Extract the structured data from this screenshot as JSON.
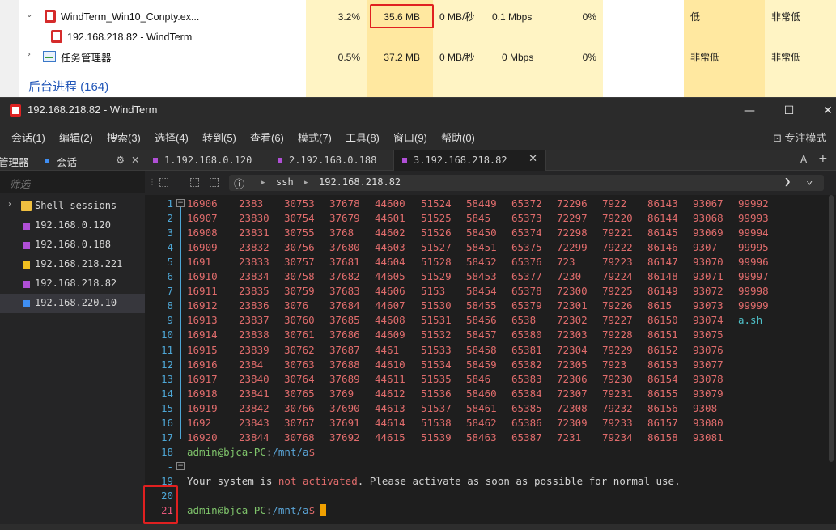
{
  "taskmanager": {
    "rows": [
      {
        "name": "WindTerm_Win10_Conpty.ex...",
        "cpu": "3.2%",
        "memory": "35.6 MB",
        "disk": "0 MB/秒",
        "network": "0.1 Mbps",
        "gpu": "0%",
        "power": "低",
        "power_trend": "非常低"
      },
      {
        "name": "192.168.218.82 - WindTerm"
      },
      {
        "name": "任务管理器",
        "cpu": "0.5%",
        "memory": "37.2 MB",
        "disk": "0 MB/秒",
        "network": "0 Mbps",
        "gpu": "0%",
        "power": "非常低",
        "power_trend": "非常低"
      }
    ],
    "section_title": "后台进程 (164)"
  },
  "windterm": {
    "title": "192.168.218.82 - WindTerm",
    "window_buttons": {
      "minimize": "—",
      "maximize": "☐",
      "close": "✕"
    },
    "menu": [
      "会话(1)",
      "编辑(2)",
      "搜索(3)",
      "选择(4)",
      "转到(5)",
      "查看(6)",
      "模式(7)",
      "工具(8)",
      "窗口(9)",
      "帮助(0)"
    ],
    "focus_mode": "⊡ 专注模式",
    "sidebar": {
      "tab_manager": "管理器",
      "tab_session": "会话",
      "filter_placeholder": "筛选",
      "folder": "Shell sessions",
      "items": [
        {
          "label": "192.168.0.120",
          "color": "#b04fd6"
        },
        {
          "label": "192.168.0.188",
          "color": "#b04fd6"
        },
        {
          "label": "192.168.218.221",
          "color": "#f0c020"
        },
        {
          "label": "192.168.218.82",
          "color": "#b04fd6"
        },
        {
          "label": "192.168.220.10",
          "color": "#3f8ef2"
        }
      ]
    },
    "tabs": [
      {
        "label": "1.192.168.0.120",
        "color": "#b04fd6"
      },
      {
        "label": "2.192.168.0.188",
        "color": "#b04fd6"
      },
      {
        "label": "3.192.168.218.82",
        "color": "#b04fd6",
        "close": "✕"
      }
    ],
    "tabbar_right": {
      "a": "A",
      "plus": "+"
    },
    "toolbar": {
      "info": "ⓘ",
      "seg1": "ssh",
      "seg2": "192.168.218.82",
      "arrow": "❯",
      "chev": "⌄"
    },
    "terminal": {
      "grid": [
        [
          "16906",
          "2383",
          "30753",
          "37678",
          "44600",
          "51524",
          "58449",
          "65372",
          "72296",
          "7922",
          "86143",
          "93067",
          "99992"
        ],
        [
          "16907",
          "23830",
          "30754",
          "37679",
          "44601",
          "51525",
          "5845",
          "65373",
          "72297",
          "79220",
          "86144",
          "93068",
          "99993"
        ],
        [
          "16908",
          "23831",
          "30755",
          "3768",
          "44602",
          "51526",
          "58450",
          "65374",
          "72298",
          "79221",
          "86145",
          "93069",
          "99994"
        ],
        [
          "16909",
          "23832",
          "30756",
          "37680",
          "44603",
          "51527",
          "58451",
          "65375",
          "72299",
          "79222",
          "86146",
          "9307",
          "99995"
        ],
        [
          "1691",
          "23833",
          "30757",
          "37681",
          "44604",
          "51528",
          "58452",
          "65376",
          "723",
          "79223",
          "86147",
          "93070",
          "99996"
        ],
        [
          "16910",
          "23834",
          "30758",
          "37682",
          "44605",
          "51529",
          "58453",
          "65377",
          "7230",
          "79224",
          "86148",
          "93071",
          "99997"
        ],
        [
          "16911",
          "23835",
          "30759",
          "37683",
          "44606",
          "5153",
          "58454",
          "65378",
          "72300",
          "79225",
          "86149",
          "93072",
          "99998"
        ],
        [
          "16912",
          "23836",
          "3076",
          "37684",
          "44607",
          "51530",
          "58455",
          "65379",
          "72301",
          "79226",
          "8615",
          "93073",
          "99999"
        ],
        [
          "16913",
          "23837",
          "30760",
          "37685",
          "44608",
          "51531",
          "58456",
          "6538",
          "72302",
          "79227",
          "86150",
          "93074",
          "a.sh"
        ],
        [
          "16914",
          "23838",
          "30761",
          "37686",
          "44609",
          "51532",
          "58457",
          "65380",
          "72303",
          "79228",
          "86151",
          "93075",
          ""
        ],
        [
          "16915",
          "23839",
          "30762",
          "37687",
          "4461",
          "51533",
          "58458",
          "65381",
          "72304",
          "79229",
          "86152",
          "93076",
          ""
        ],
        [
          "16916",
          "2384",
          "30763",
          "37688",
          "44610",
          "51534",
          "58459",
          "65382",
          "72305",
          "7923",
          "86153",
          "93077",
          ""
        ],
        [
          "16917",
          "23840",
          "30764",
          "37689",
          "44611",
          "51535",
          "5846",
          "65383",
          "72306",
          "79230",
          "86154",
          "93078",
          ""
        ],
        [
          "16918",
          "23841",
          "30765",
          "3769",
          "44612",
          "51536",
          "58460",
          "65384",
          "72307",
          "79231",
          "86155",
          "93079",
          ""
        ],
        [
          "16919",
          "23842",
          "30766",
          "37690",
          "44613",
          "51537",
          "58461",
          "65385",
          "72308",
          "79232",
          "86156",
          "9308",
          ""
        ],
        [
          "1692",
          "23843",
          "30767",
          "37691",
          "44614",
          "51538",
          "58462",
          "65386",
          "72309",
          "79233",
          "86157",
          "93080",
          ""
        ],
        [
          "16920",
          "23844",
          "30768",
          "37692",
          "44615",
          "51539",
          "58463",
          "65387",
          "7231",
          "79234",
          "86158",
          "93081",
          ""
        ]
      ],
      "line_numbers": [
        "1",
        "2",
        "3",
        "4",
        "5",
        "6",
        "7",
        "8",
        "9",
        "10",
        "11",
        "12",
        "13",
        "14",
        "15",
        "16",
        "17",
        "18",
        "-",
        "19",
        "20",
        "21"
      ],
      "prompt_user": "admin@bjca-PC",
      "prompt_sep": ":",
      "prompt_path": "/mnt/a",
      "prompt_dollar": "$",
      "msg_a": "Your system is ",
      "msg_b": "not activated",
      "msg_c": ". Please activate as soon as possible for normal use."
    }
  }
}
